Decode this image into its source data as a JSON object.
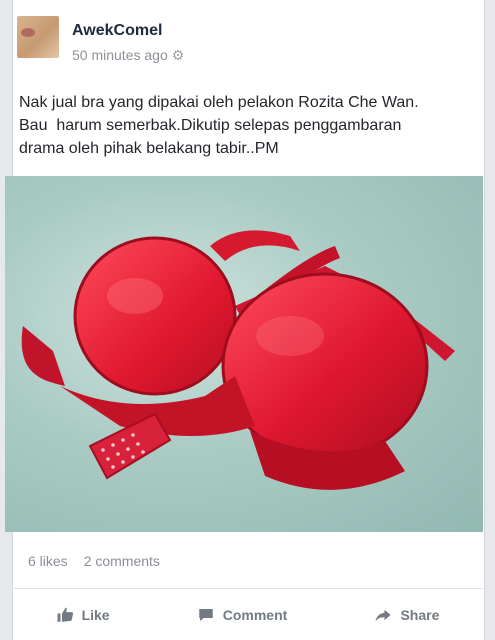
{
  "post": {
    "author": "AwekComel",
    "timestamp": "50 minutes ago",
    "text": "Nak jual bra yang dipakai oleh pelakon Rozita Che Wan.\nBau  harum semerbak.Dikutip selepas penggambaran\ndrama oleh pihak belakang tabir..PM",
    "likes": "6 likes",
    "comments": "2 comments"
  },
  "actions": {
    "like": "Like",
    "comment": "Comment",
    "share": "Share"
  },
  "colors": {
    "text": "#23262b",
    "muted": "#8a8f97",
    "action": "#737985",
    "photo_item": "#e0182f"
  },
  "icons": {
    "settings": "gear-icon",
    "like": "thumbs-up-icon",
    "comment": "speech-bubble-icon",
    "share": "share-arrow-icon"
  }
}
